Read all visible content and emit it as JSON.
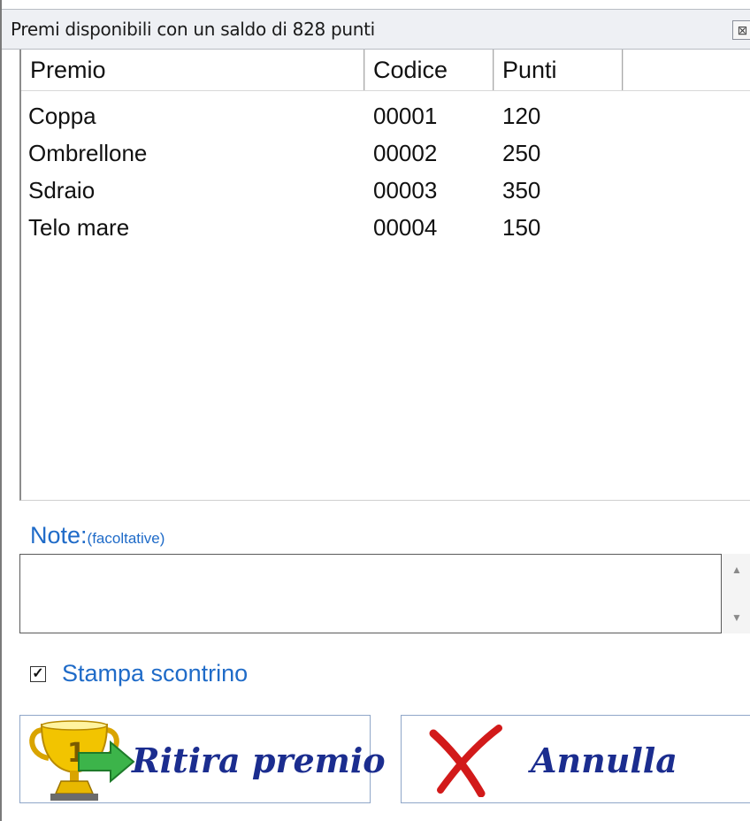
{
  "window": {
    "title": "Premi disponibili con un saldo di 828 punti",
    "close_glyph": "⊠"
  },
  "table": {
    "headers": [
      "Premio",
      "Codice",
      "Punti"
    ],
    "rows": [
      {
        "premio": "Coppa",
        "codice": "00001",
        "punti": "120"
      },
      {
        "premio": "Ombrellone",
        "codice": "00002",
        "punti": "250"
      },
      {
        "premio": "Sdraio",
        "codice": "00003",
        "punti": "350"
      },
      {
        "premio": "Telo mare",
        "codice": "00004",
        "punti": "150"
      }
    ]
  },
  "note": {
    "label": "Note:",
    "sublabel": "(facoltative)",
    "value": "",
    "scroll_up": "▲",
    "scroll_down": "▼"
  },
  "print_receipt": {
    "label": "Stampa scontrino",
    "checked": true,
    "check_glyph": "✓"
  },
  "buttons": {
    "ritira": "Ritira premio",
    "annulla": "Annulla"
  },
  "icons": {
    "trophy": "trophy-icon",
    "arrow": "green-arrow-icon",
    "cancel": "red-x-icon"
  },
  "colors": {
    "accent_blue": "#1f6bc8",
    "button_text": "#1b2d8f",
    "cancel_red": "#d21a1a",
    "arrow_green": "#3cb44a",
    "trophy_gold": "#e8b800"
  }
}
